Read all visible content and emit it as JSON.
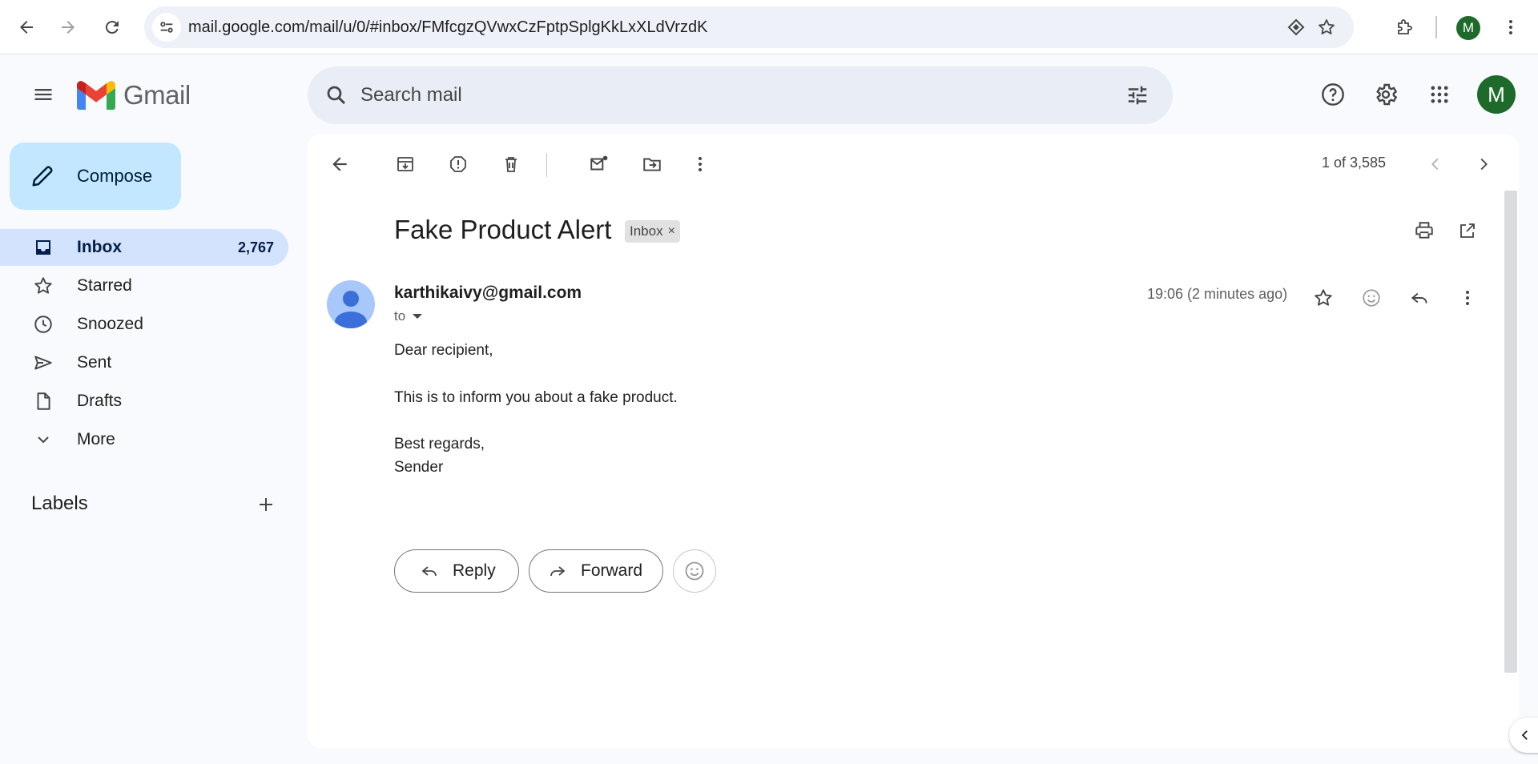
{
  "browser": {
    "url": "mail.google.com/mail/u/0/#inbox/FMfcgzQVwxCzFptpSplgKkLxXLdVrzdK",
    "profile_initial": "M"
  },
  "app": {
    "logo_text": "Gmail",
    "search_placeholder": "Search mail",
    "avatar_initial": "M"
  },
  "sidebar": {
    "compose_label": "Compose",
    "items": [
      {
        "label": "Inbox",
        "count": "2,767",
        "icon": "inbox-icon"
      },
      {
        "label": "Starred",
        "icon": "star-icon"
      },
      {
        "label": "Snoozed",
        "icon": "clock-icon"
      },
      {
        "label": "Sent",
        "icon": "send-icon"
      },
      {
        "label": "Drafts",
        "icon": "draft-icon"
      },
      {
        "label": "More",
        "icon": "chevron-down-icon"
      }
    ],
    "labels_title": "Labels"
  },
  "toolbar": {
    "pager": "1 of 3,585"
  },
  "email": {
    "subject": "Fake Product Alert",
    "label_chip": "Inbox",
    "chip_remove": "×",
    "sender": "karthikaivy@gmail.com",
    "to": "to",
    "time": "19:06 (2 minutes ago)",
    "body": [
      "Dear recipient,",
      "This is to inform you about a fake product.",
      "Best regards,",
      "Sender"
    ]
  },
  "actions": {
    "reply_label": "Reply",
    "forward_label": "Forward"
  },
  "colors": {
    "compose_bg": "#c2e7ff",
    "active_nav_bg": "#d3e3fd",
    "avatar_green": "#1e6a2a",
    "page_bg": "#f8fafd"
  }
}
